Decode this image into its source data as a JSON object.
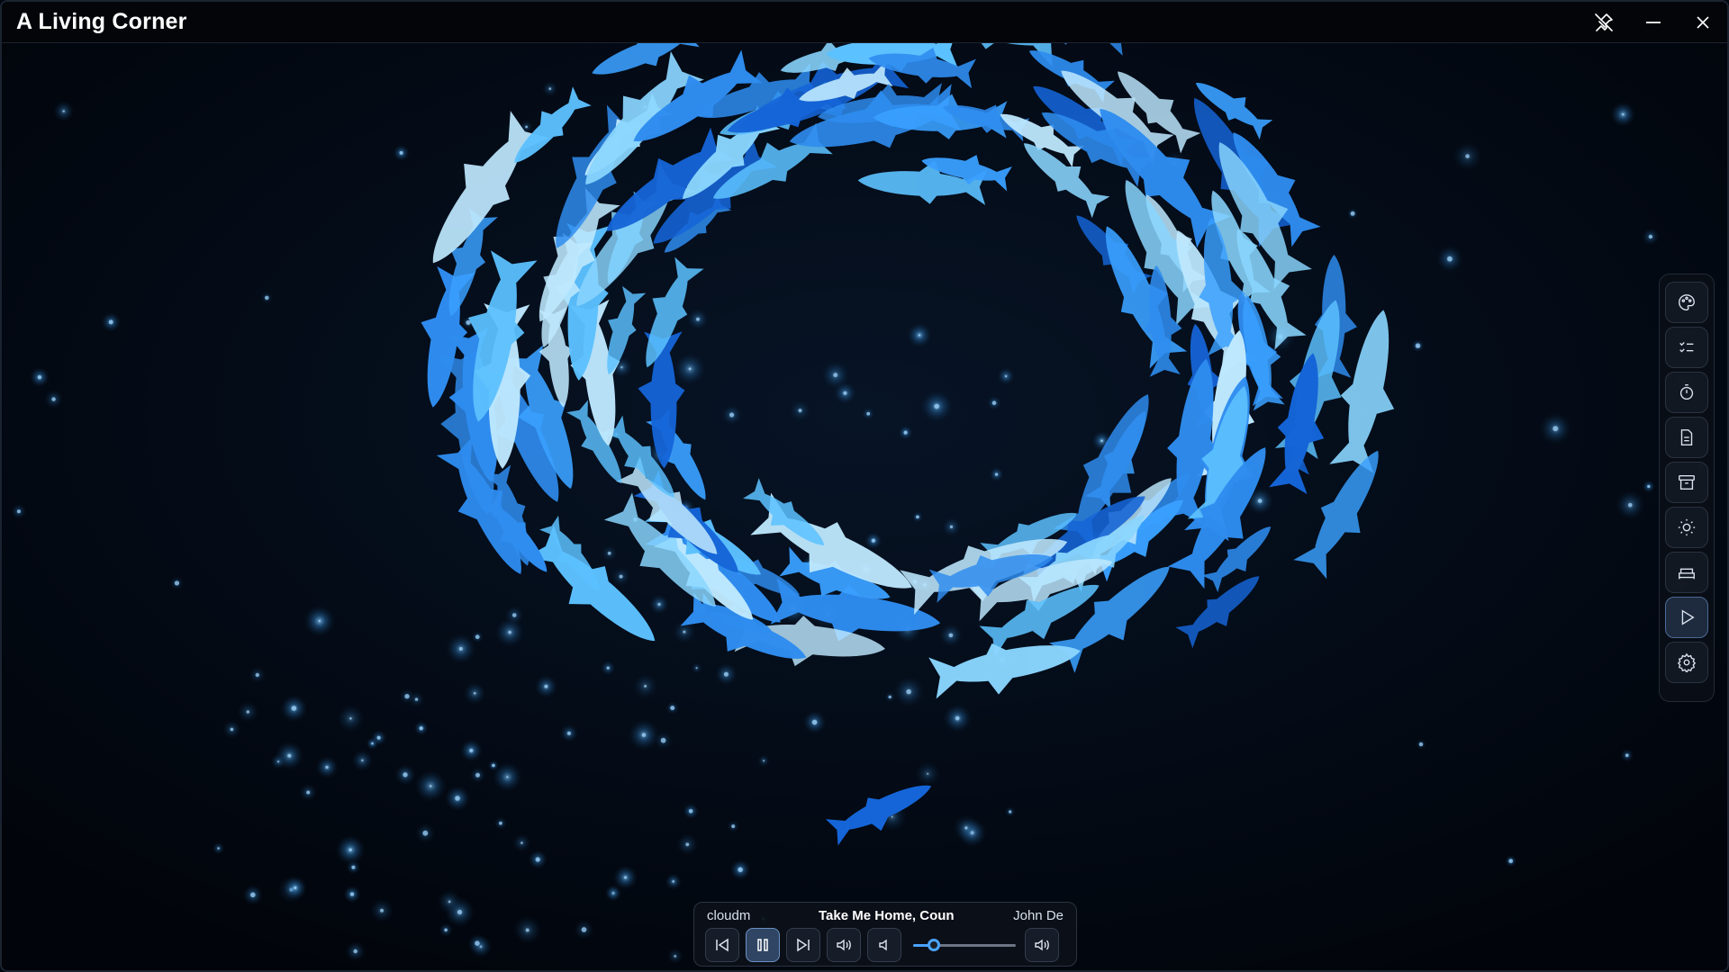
{
  "window": {
    "title": "A Living Corner"
  },
  "titlebar": {
    "controls": [
      {
        "icon": "unpin-icon"
      },
      {
        "icon": "minimize-icon"
      },
      {
        "icon": "close-icon"
      }
    ]
  },
  "sidebar": {
    "items": [
      {
        "id": "themes",
        "icon": "palette-icon"
      },
      {
        "id": "todo",
        "icon": "checklist-icon"
      },
      {
        "id": "timer",
        "icon": "stopwatch-icon"
      },
      {
        "id": "notes",
        "icon": "note-icon"
      },
      {
        "id": "archive",
        "icon": "archive-icon"
      },
      {
        "id": "brightness",
        "icon": "sun-icon"
      },
      {
        "id": "sleep",
        "icon": "bed-icon"
      },
      {
        "id": "play",
        "icon": "play-icon",
        "active": true
      },
      {
        "id": "settings",
        "icon": "gear-icon"
      }
    ]
  },
  "player": {
    "source": "cloudm",
    "song": "Take Me Home, Coun",
    "artist": "John De",
    "volume": 0.2,
    "state": "playing"
  },
  "colors": {
    "background": "#02060d",
    "accent": "#4aa3ff",
    "fish_light": "#bfe9ff",
    "fish_mid": "#5cc1ff",
    "fish_dark": "#1565d8"
  }
}
